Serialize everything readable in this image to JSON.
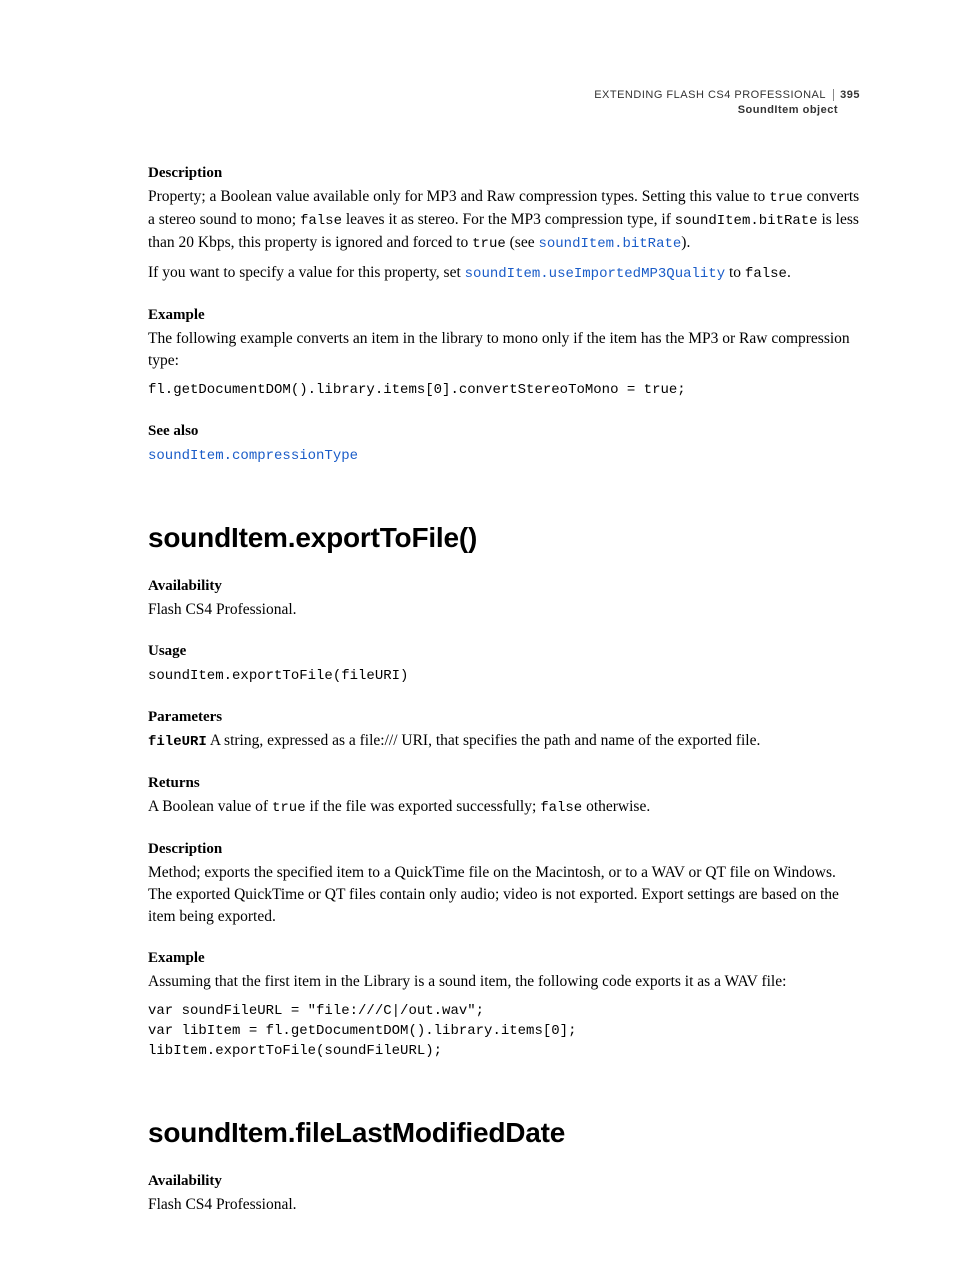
{
  "header": {
    "book": "EXTENDING FLASH CS4 PROFESSIONAL",
    "page": "395",
    "section": "SoundItem object"
  },
  "sec1": {
    "h_desc": "Description",
    "desc_p1_a": "Property; a Boolean value available only for MP3 and Raw compression types. Setting this value to ",
    "desc_p1_true": "true",
    "desc_p1_b": " converts a stereo sound to mono; ",
    "desc_p1_false": "false",
    "desc_p1_c": " leaves it as stereo. For the MP3 compression type, if ",
    "desc_p1_bitrate": "soundItem.bitRate",
    "desc_p1_d": " is less than 20 Kbps, this property is ignored and forced to ",
    "desc_p1_true2": "true",
    "desc_p1_e": " (see ",
    "desc_p1_link": "soundItem.bitRate",
    "desc_p1_f": ").",
    "desc_p2_a": "If you want to specify a value for this property, set ",
    "desc_p2_link": "soundItem.useImportedMP3Quality",
    "desc_p2_b": " to ",
    "desc_p2_false": "false",
    "desc_p2_c": ".",
    "h_example": "Example",
    "example_p": "The following example converts an item in the library to mono only if the item has the MP3 or Raw compression type:",
    "example_code": "fl.getDocumentDOM().library.items[0].convertStereoToMono = true;",
    "h_seealso": "See also",
    "seealso_link": "soundItem.compressionType"
  },
  "sec2": {
    "title": "soundItem.exportToFile()",
    "h_avail": "Availability",
    "avail_p": "Flash CS4 Professional.",
    "h_usage": "Usage",
    "usage_code": "soundItem.exportToFile(fileURI)",
    "h_params": "Parameters",
    "param_name": "fileURI",
    "param_desc": "  A string, expressed as a file:/// URI, that specifies the path and name of the exported file.",
    "h_returns": "Returns",
    "returns_a": "A Boolean value of ",
    "returns_true": "true",
    "returns_b": " if the file was exported successfully; ",
    "returns_false": "false",
    "returns_c": " otherwise.",
    "h_desc": "Description",
    "desc_p": "Method; exports the specified item to a QuickTime file on the Macintosh, or to a WAV or QT file on Windows. The exported QuickTime or QT files contain only audio; video is not exported. Export settings are based on the item being exported.",
    "h_example": "Example",
    "example_p": "Assuming that the first item in the Library is a sound item, the following code exports it as a WAV file:",
    "example_code": "var soundFileURL = \"file:///C|/out.wav\";\nvar libItem = fl.getDocumentDOM().library.items[0];\nlibItem.exportToFile(soundFileURL);"
  },
  "sec3": {
    "title": "soundItem.fileLastModifiedDate",
    "h_avail": "Availability",
    "avail_p": "Flash CS4 Professional."
  }
}
